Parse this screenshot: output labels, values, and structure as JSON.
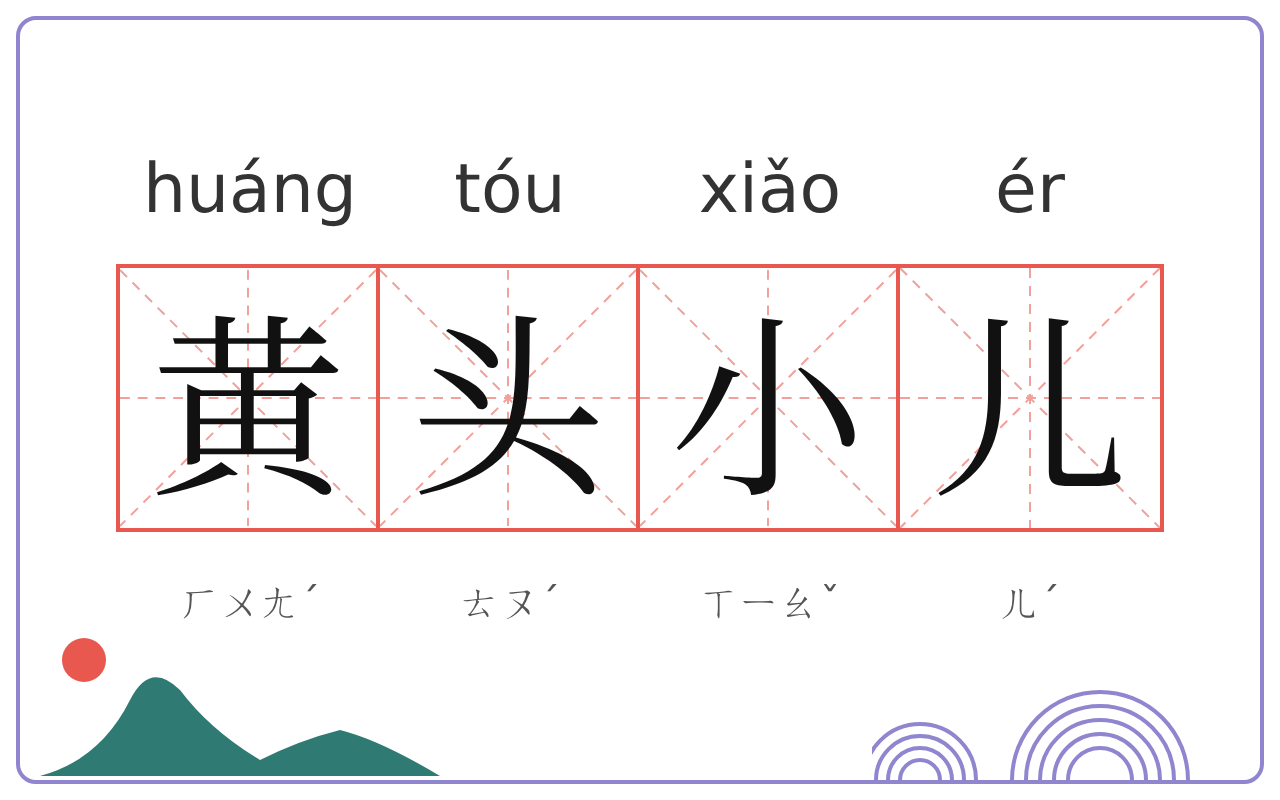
{
  "syllables": [
    {
      "pinyin": "huáng",
      "character": "黄",
      "zhuyin": "ㄏㄨㄤˊ"
    },
    {
      "pinyin": "tóu",
      "character": "头",
      "zhuyin": "ㄊㄡˊ"
    },
    {
      "pinyin": "xiǎo",
      "character": "小",
      "zhuyin": "ㄒㄧㄠˇ"
    },
    {
      "pinyin": "ér",
      "character": "儿",
      "zhuyin": "ㄦˊ"
    }
  ]
}
